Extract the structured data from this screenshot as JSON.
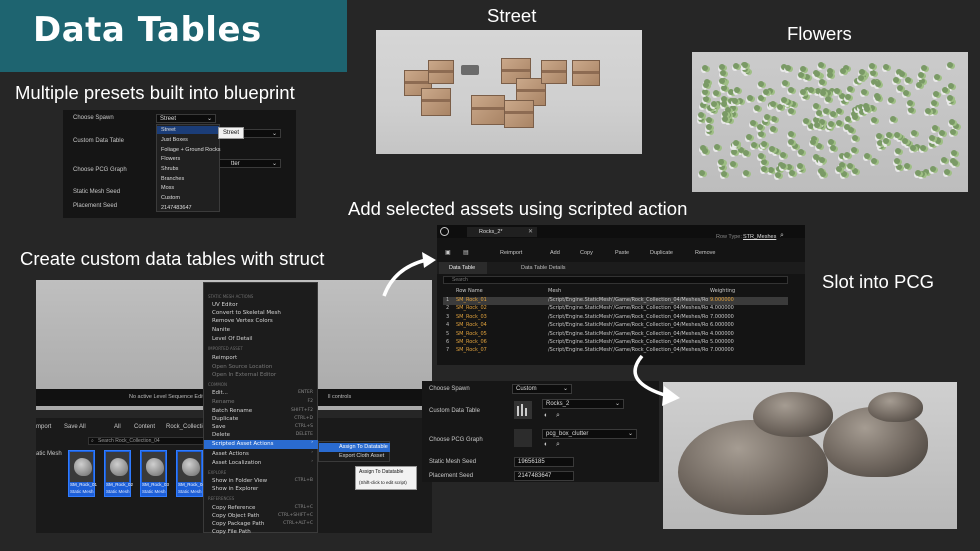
{
  "banner": {
    "title": "Data Tables"
  },
  "headings": {
    "street": "Street",
    "flowers": "Flowers",
    "presets": "Multiple presets built into blueprint",
    "custom": "Create custom data tables with struct",
    "scripted": "Add selected assets using scripted action",
    "pcg": "Slot into PCG"
  },
  "spawn_panel": {
    "labels": [
      "Choose Spawn",
      "Custom Data Table",
      "Choose PCG Graph",
      "Static Mesh Seed",
      "Placement Seed"
    ],
    "selected": "Street",
    "options": [
      "Street",
      "Just Boxes",
      "Foliage + Ground Rocks",
      "Flowers",
      "Shrubs",
      "Branches",
      "Moss",
      "Custom",
      "2147483647"
    ],
    "tooltip": "Street",
    "partial_value": "tter"
  },
  "viewport": {
    "status": "No active Level Sequence Editor",
    "status_right": "ll controls"
  },
  "content_browser": {
    "toolbar": [
      "mport",
      "Save All"
    ],
    "breadcrumb": [
      "All",
      "Content",
      "Rock_Collection"
    ],
    "search_placeholder": "Search Rock_Collection_04",
    "left_item": "atic Mesh",
    "assets": [
      {
        "name": "SM_Rock_01",
        "type": "Static Mesh"
      },
      {
        "name": "SM_Rock_02",
        "type": "Static Mesh"
      },
      {
        "name": "SM_Rock_03",
        "type": "Static Mesh"
      },
      {
        "name": "SM_Rock_04",
        "type": "Static Mesh"
      },
      {
        "name": "SM_Rock_05",
        "type": "Static Mesh"
      }
    ]
  },
  "context_menu": {
    "sec1": "STATIC MESH ACTIONS",
    "group1": [
      "UV Editor",
      "Convert to Skeletal Mesh",
      "Remove Vertex Colors",
      "Nanite",
      "Level Of Detail"
    ],
    "sec2": "IMPORTED ASSET",
    "group2": [
      "Reimport",
      "Open Source Location",
      "Open In External Editor"
    ],
    "sec3": "COMMON",
    "group3": [
      {
        "label": "Edit...",
        "shortcut": "ENTER"
      },
      {
        "label": "Rename",
        "shortcut": "F2"
      },
      {
        "label": "Batch Rename",
        "shortcut": "SHIFT+F2"
      },
      {
        "label": "Duplicate",
        "shortcut": "CTRL+D"
      },
      {
        "label": "Save",
        "shortcut": "CTRL+S"
      },
      {
        "label": "Delete",
        "shortcut": "DELETE"
      },
      {
        "label": "Scripted Asset Actions",
        "shortcut": ""
      },
      {
        "label": "Asset Actions",
        "shortcut": ""
      },
      {
        "label": "Asset Localization",
        "shortcut": ""
      }
    ],
    "sec4": "EXPLORE",
    "group4": [
      {
        "label": "Show in Folder View",
        "shortcut": "CTRL+B"
      },
      {
        "label": "Show in Explorer",
        "shortcut": ""
      }
    ],
    "sec5": "REFERENCES",
    "group5": [
      {
        "label": "Copy Reference",
        "shortcut": "CTRL+C"
      },
      {
        "label": "Copy Object Path",
        "shortcut": "CTRL+SHIFT+C"
      },
      {
        "label": "Copy Package Path",
        "shortcut": "CTRL+ALT+C"
      },
      {
        "label": "Copy File Path",
        "shortcut": ""
      }
    ],
    "submenu": [
      "Assign To Datatable",
      "Export Cloth Asset"
    ],
    "tooltip_title": "Assign To Datatable",
    "tooltip_body": "(Shift-click to edit script)"
  },
  "data_table": {
    "tab": "Rocks_2*",
    "row_type_label": "Row Type:",
    "row_type": "STR_Meshes",
    "toolbar": [
      "Reimport",
      "Add",
      "Copy",
      "Paste",
      "Duplicate",
      "Remove"
    ],
    "subtabs": [
      "Data Table",
      "Data Table Details"
    ],
    "search_placeholder": "Search",
    "columns": [
      "Row Name",
      "Mesh",
      "Weighting"
    ],
    "rows": [
      {
        "n": "1",
        "name": "SM_Rock_01",
        "mesh": "/Script/Engine.StaticMesh'/Game/Rock_Collection_04/Meshes/Ro",
        "w": "9.000000"
      },
      {
        "n": "2",
        "name": "SM_Rock_02",
        "mesh": "/Script/Engine.StaticMesh'/Game/Rock_Collection_04/Meshes/Ro",
        "w": "4.000000"
      },
      {
        "n": "3",
        "name": "SM_Rock_03",
        "mesh": "/Script/Engine.StaticMesh'/Game/Rock_Collection_04/Meshes/Ro",
        "w": "7.000000"
      },
      {
        "n": "4",
        "name": "SM_Rock_04",
        "mesh": "/Script/Engine.StaticMesh'/Game/Rock_Collection_04/Meshes/Ro",
        "w": "6.000000"
      },
      {
        "n": "5",
        "name": "SM_Rock_05",
        "mesh": "/Script/Engine.StaticMesh'/Game/Rock_Collection_04/Meshes/Ro",
        "w": "4.000000"
      },
      {
        "n": "6",
        "name": "SM_Rock_06",
        "mesh": "/Script/Engine.StaticMesh'/Game/Rock_Collection_04/Meshes/Ro",
        "w": "5.000000"
      },
      {
        "n": "7",
        "name": "SM_Rock_07",
        "mesh": "/Script/Engine.StaticMesh'/Game/Rock_Collection_04/Meshes/Ro",
        "w": "7.000000"
      }
    ]
  },
  "pcg_panel": {
    "labels": [
      "Choose Spawn",
      "Custom Data Table",
      "Choose PCG Graph",
      "Static Mesh Seed",
      "Placement Seed"
    ],
    "spawn_value": "Custom",
    "datatable_value": "Rocks_2",
    "graph_value": "pcg_box_clutter",
    "mesh_seed": "19656185",
    "placement_seed": "2147483647"
  },
  "colors": {
    "banner": "#1e6470",
    "background": "#262626",
    "selection": "#2a6bd0",
    "row_name": "#e0a13c"
  }
}
